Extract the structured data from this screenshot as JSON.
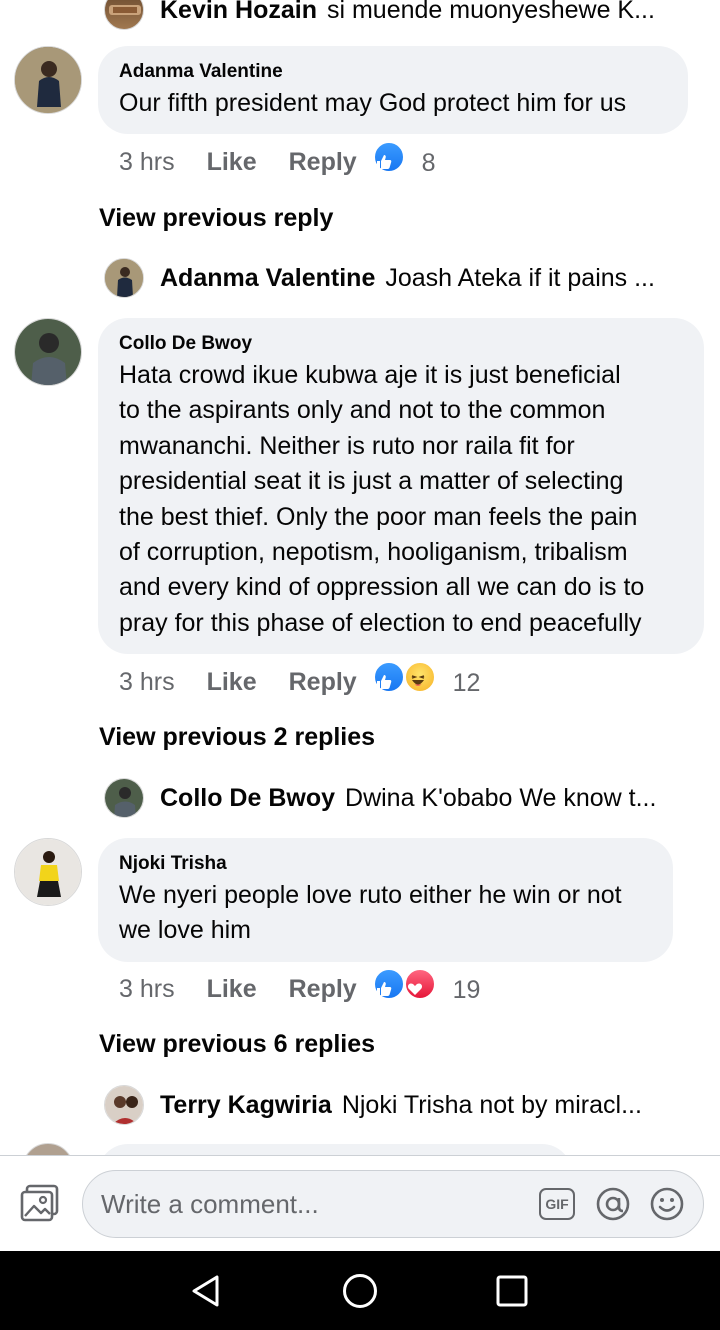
{
  "comments": [
    {
      "author": "Adanma Valentine",
      "text": "Our fifth president may God protect him for us",
      "time": "3 hrs",
      "like_label": "Like",
      "reply_label": "Reply",
      "reaction_count": "8",
      "reactions": [
        "like-icon"
      ],
      "view_previous": "View previous reply",
      "latest_reply": {
        "author": "Adanma Valentine",
        "text": "Joash Ateka if it pains ..."
      }
    },
    {
      "author": "Collo De Bwoy",
      "text_lines": [
        "Hata crowd ikue kubwa aje it is just beneficial",
        "to the aspirants only and not to the common",
        "mwananchi. Neither is ruto nor raila fit for",
        "presidential seat it is just a matter of selecting",
        "the best thief. Only the poor man feels the pain",
        "of corruption, nepotism, hooliganism, tribalism",
        "and every kind of oppression all we can do is to",
        "pray for this phase of election to end peacefully"
      ],
      "time": "3 hrs",
      "like_label": "Like",
      "reply_label": "Reply",
      "reaction_count": "12",
      "reactions": [
        "like-icon",
        "haha-icon"
      ],
      "view_previous": "View previous 2 replies",
      "latest_reply": {
        "author": "Collo De Bwoy",
        "text": "Dwina K'obabo We know t..."
      }
    },
    {
      "author": "Njoki Trisha",
      "text_lines": [
        "We nyeri people love ruto either he win or not",
        "we love him"
      ],
      "time": "3 hrs",
      "like_label": "Like",
      "reply_label": "Reply",
      "reaction_count": "19",
      "reactions": [
        "like-icon",
        "love-icon"
      ],
      "view_previous": "View previous 6 replies",
      "latest_reply": {
        "author": "Terry Kagwiria",
        "text": "Njoki Trisha not by miracl..."
      }
    }
  ],
  "top_reply": {
    "author": "Kevin Hozain",
    "text": "si muende muonyeshewe K..."
  },
  "composer": {
    "placeholder": "Write a comment...",
    "gif_label": "GIF",
    "icons": [
      "photo-icon",
      "gif-icon",
      "mention-icon",
      "emoji-icon"
    ]
  },
  "nav": [
    "back-icon",
    "home-icon",
    "recents-icon"
  ],
  "colors": {
    "bubble": "#f0f2f5",
    "meta_text": "#65676b",
    "like_blue": "#1877f2",
    "love_red": "#e61739",
    "haha_yellow": "#f7b125"
  }
}
